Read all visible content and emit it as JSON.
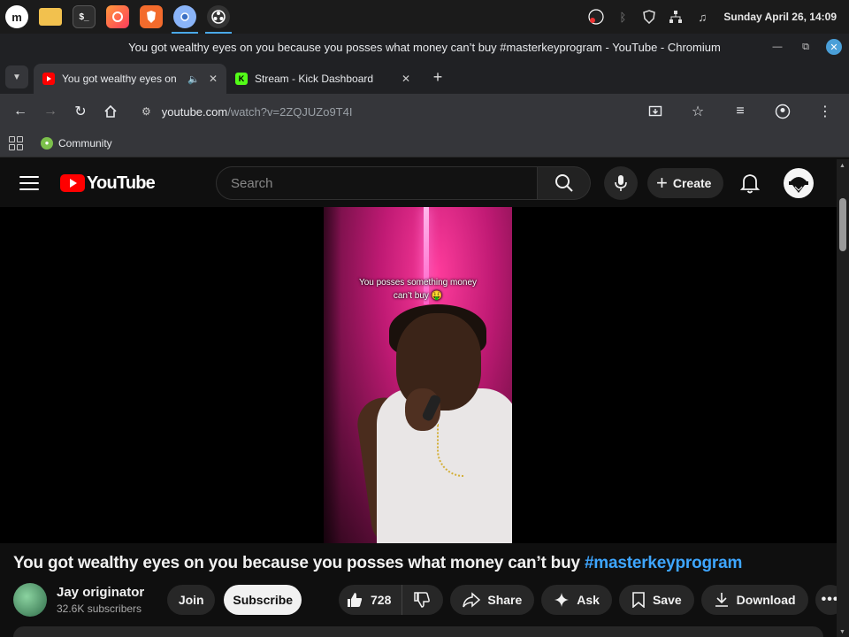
{
  "taskbar": {
    "apps": [
      {
        "name": "linux-mint-menu-icon",
        "label": "m",
        "color": "#1f1f1f"
      },
      {
        "name": "files-folder-icon",
        "label": "",
        "color": "#f2c14e"
      },
      {
        "name": "terminal-icon",
        "label": "$_",
        "color": "#333333"
      },
      {
        "name": "firefox-app-icon",
        "label": "",
        "color": "#ff5b3a"
      },
      {
        "name": "brave-app-icon",
        "label": "",
        "color": "#f36b2c"
      },
      {
        "name": "chromium-app-icon",
        "label": "",
        "color": "#5f8fc8"
      },
      {
        "name": "obs-app-icon",
        "label": "",
        "color": "#3a3a3a"
      }
    ],
    "clock": "Sunday April 26, 14:09"
  },
  "window": {
    "title": "You got wealthy eyes on you because you posses what money can’t buy #masterkeyprogram - YouTube - Chromium"
  },
  "tabs": [
    {
      "title": "You got wealthy eyes on",
      "favicon_color": "#ff0000",
      "active": true,
      "audio": true
    },
    {
      "title": "Stream - Kick Dashboard",
      "favicon_color": "#53fc18",
      "favicon_letter": "K",
      "active": false,
      "audio": false
    }
  ],
  "toolbar": {
    "url_host": "youtube.com",
    "url_path": "/watch?v=2ZQJUZo9T4I"
  },
  "bookmarks": [
    {
      "label": "Community"
    }
  ],
  "youtube": {
    "logo_text": "YouTube",
    "search_placeholder": "Search",
    "create_label": "Create",
    "video": {
      "caption_line1": "You posses something money",
      "caption_line2": "can’t buy 🤑",
      "title_main": "You got wealthy eyes on you because you posses what money can’t buy ",
      "title_hashtag": "#masterkeyprogram"
    },
    "channel": {
      "name": "Jay originator",
      "subscribers": "32.6K subscribers",
      "join_label": "Join",
      "subscribe_label": "Subscribe"
    },
    "actions": {
      "likes": "728",
      "share_label": "Share",
      "ask_label": "Ask",
      "save_label": "Save",
      "download_label": "Download"
    }
  }
}
